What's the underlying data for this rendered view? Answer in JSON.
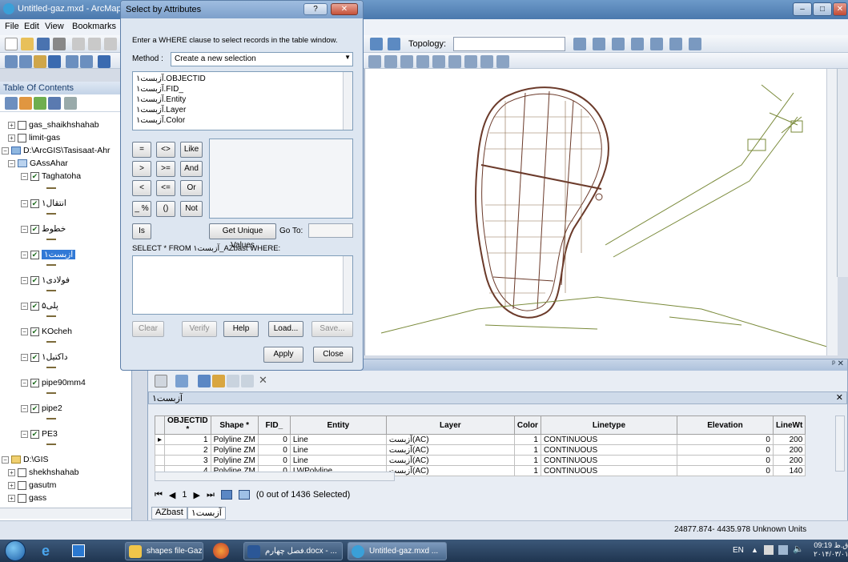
{
  "app": {
    "title": "Untitled-gaz.mxd - ArcMap - A",
    "menus": [
      "File",
      "Edit",
      "View",
      "Bookmarks"
    ],
    "topology_label": "Topology:"
  },
  "toc": {
    "header": "Table Of Contents",
    "items": [
      {
        "label": "gas_shaikhshahab",
        "checked": false
      },
      {
        "label": "limit-gas",
        "checked": false
      },
      {
        "label": "D:\\ArcGIS\\Tasisaat-Ahr",
        "checked": null
      },
      {
        "label": "GAssAhar",
        "checked": null
      },
      {
        "label": "Taghatoha",
        "checked": true
      },
      {
        "label": "انتقال۱",
        "checked": true
      },
      {
        "label": "خطوط",
        "checked": true
      },
      {
        "label": "آزبست۱",
        "checked": true
      },
      {
        "label": "فولادی۱",
        "checked": true
      },
      {
        "label": "پلی۵",
        "checked": true
      },
      {
        "label": "KOcheh",
        "checked": true
      },
      {
        "label": "داكتيل۱",
        "checked": true
      },
      {
        "label": "pipe90mm4",
        "checked": true
      },
      {
        "label": "pipe2",
        "checked": true
      },
      {
        "label": "PE3",
        "checked": true
      },
      {
        "label": "D:\\GIS",
        "checked": null
      },
      {
        "label": "shekhshahab",
        "checked": false
      },
      {
        "label": "gasutm",
        "checked": false
      },
      {
        "label": "gass",
        "checked": false
      }
    ]
  },
  "dialog": {
    "title": "Select by Attributes",
    "instruction": "Enter a WHERE clause to select records in the table window.",
    "method_label": "Method :",
    "method_value": "Create a new selection",
    "fields": [
      "آزبست۱.OBJECTID",
      "آزبست۱.FID_",
      "آزبست۱.Entity",
      "آزبست۱.Layer",
      "آزبست۱.Color"
    ],
    "operators": [
      "=",
      "<>",
      "Like",
      ">",
      ">=",
      "And",
      "<",
      "<=",
      "Or",
      "_ %",
      "()",
      "Not",
      "Is"
    ],
    "get_unique": "Get Unique Values",
    "goto": "Go To:",
    "select_from": "SELECT * FROM آزبست۱_AZbast WHERE:",
    "buttons": {
      "clear": "Clear",
      "verify": "Verify",
      "help": "Help",
      "load": "Load...",
      "save": "Save...",
      "apply": "Apply",
      "close": "Close"
    }
  },
  "table": {
    "tab_title": "آزبست۱",
    "columns": [
      "OBJECTID *",
      "Shape *",
      "FID_",
      "Entity",
      "Layer",
      "Color",
      "Linetype",
      "Elevation",
      "LineWt"
    ],
    "rows": [
      [
        "1",
        "Polyline ZM",
        "0",
        "Line",
        "آزبست(AC)",
        "1",
        "CONTINUOUS",
        "0",
        "200"
      ],
      [
        "2",
        "Polyline ZM",
        "0",
        "Line",
        "آزبست(AC)",
        "1",
        "CONTINUOUS",
        "0",
        "200"
      ],
      [
        "3",
        "Polyline ZM",
        "0",
        "Line",
        "آزبست(AC)",
        "1",
        "CONTINUOUS",
        "0",
        "200"
      ],
      [
        "4",
        "Polyline ZM",
        "0",
        "LWPolyline",
        "آزبست(AC)",
        "1",
        "CONTINUOUS",
        "0",
        "140"
      ]
    ],
    "record_nav": "1",
    "selection_status": "(0 out of 1436 Selected)",
    "bottom_tabs": [
      "AZbast",
      "آزبست۱"
    ]
  },
  "status": {
    "coords": "24877.874- 4435.978 Unknown Units"
  },
  "taskbar": {
    "items": [
      "shapes file-Gaz",
      "فصل چهارم.docx - ...",
      "Untitled-gaz.mxd ..."
    ],
    "lang": "EN",
    "time": "09:19 ق.ظ",
    "date": "۲۰۱۴/۰۳/۰۱"
  }
}
